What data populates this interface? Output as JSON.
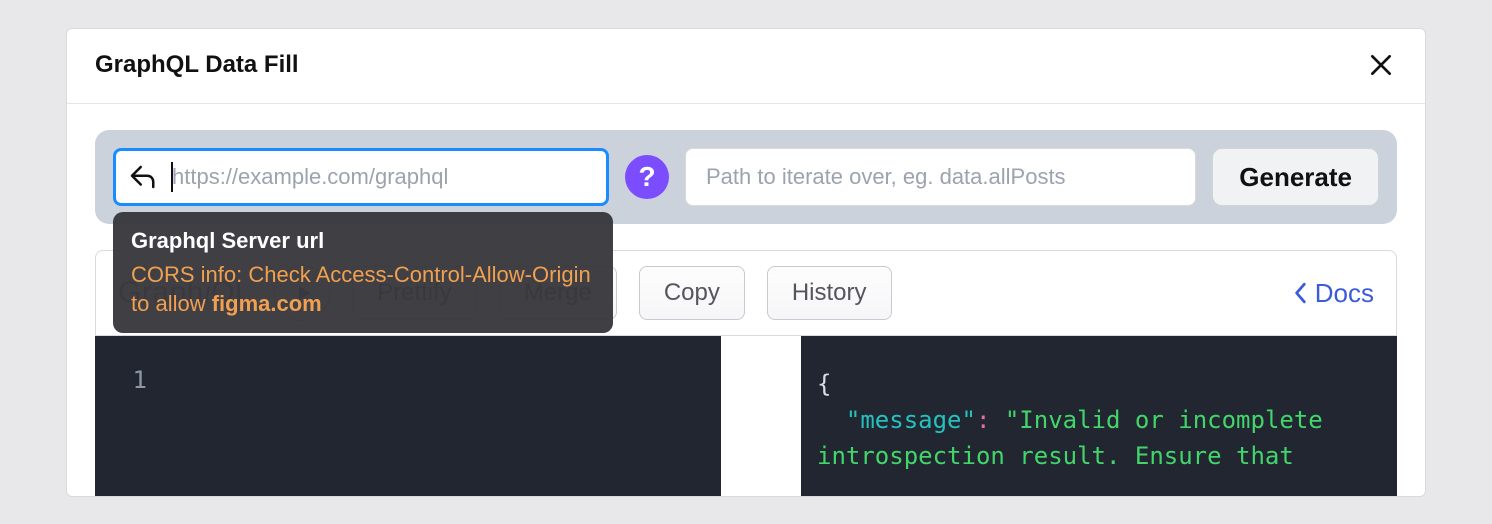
{
  "modal": {
    "title": "GraphQL Data Fill"
  },
  "toolbar": {
    "url_placeholder": "https://example.com/graphql",
    "url_value": "",
    "help_label": "?",
    "path_placeholder": "Path to iterate over, eg. data.allPosts",
    "path_value": "",
    "generate_label": "Generate"
  },
  "tooltip": {
    "title": "Graphql Server url",
    "body_prefix": "CORS info: Check Access-Control-Allow-Origin to allow ",
    "body_strong": "figma.com"
  },
  "graphiql": {
    "logo_plain1": "Graph",
    "logo_italic": "i",
    "logo_plain2": "QL",
    "buttons": {
      "prettify": "Prettify",
      "merge": "Merge",
      "copy": "Copy",
      "history": "History"
    },
    "docs_label": "Docs"
  },
  "editor": {
    "line_number": "1",
    "result": {
      "brace": "{",
      "key": "\"message\"",
      "colon": ":",
      "value_line1": "\"Invalid or incomplete",
      "value_line2": "introspection result. Ensure that"
    }
  }
}
